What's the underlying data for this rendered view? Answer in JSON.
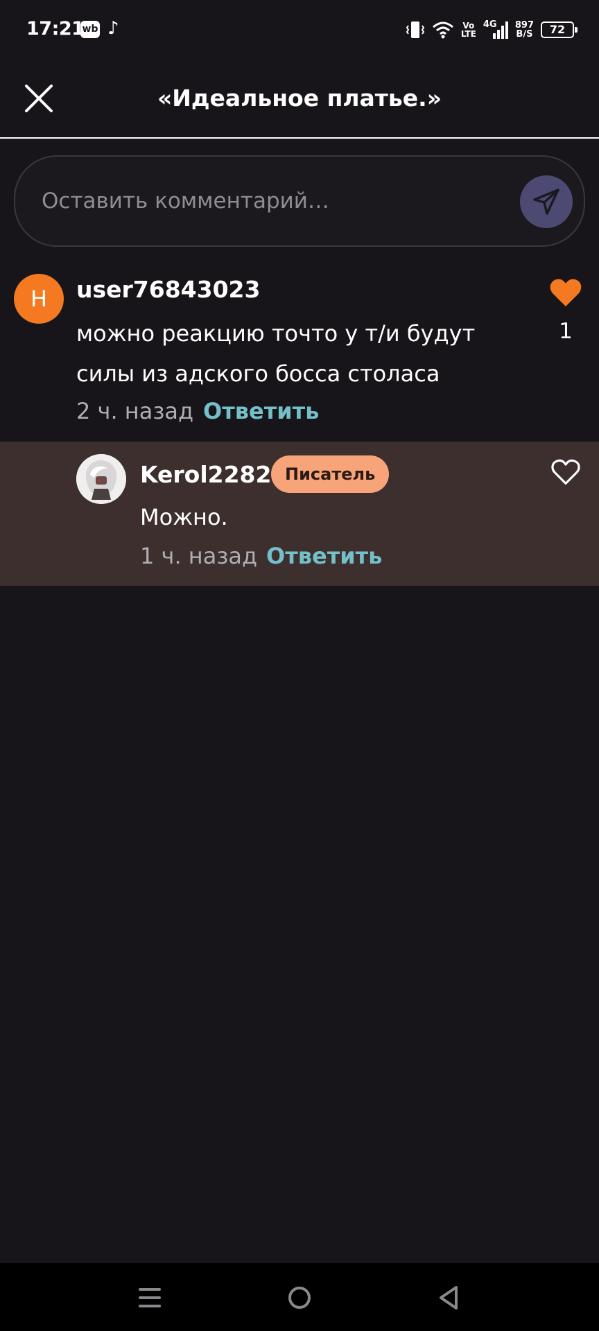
{
  "status_bar": {
    "time": "17:21",
    "app_icons": [
      "wb-icon",
      "tiktok-icon"
    ],
    "wb_label": "wb",
    "volte_line1": "Vo",
    "volte_line2": "LTE",
    "network": "4G",
    "speed_value": "897",
    "speed_unit": "B/S",
    "battery": "72"
  },
  "header": {
    "title": "«Идеальное платье.»"
  },
  "comment_input": {
    "placeholder": "Оставить комментарий…"
  },
  "comments": [
    {
      "avatar_letter": "Н",
      "username": "user76843023",
      "text_line1": "можно реакцию точто у т/и будут",
      "text_line2": "силы из адского босса столаса",
      "time": "2 ч. назад",
      "reply_label": "Ответить",
      "likes": "1",
      "liked": true
    }
  ],
  "replies": [
    {
      "username": "Kerol2282",
      "badge": "Писатель",
      "text": "Можно.",
      "time": "1 ч. назад",
      "reply_label": "Ответить",
      "liked": false
    }
  ],
  "colors": {
    "background": "#171519",
    "accent_orange": "#f47920",
    "link_teal": "#74bfc8",
    "reply_bg": "#3c2f2e",
    "badge_bg": "#f8a47a",
    "send_bg": "#4c4a73"
  }
}
